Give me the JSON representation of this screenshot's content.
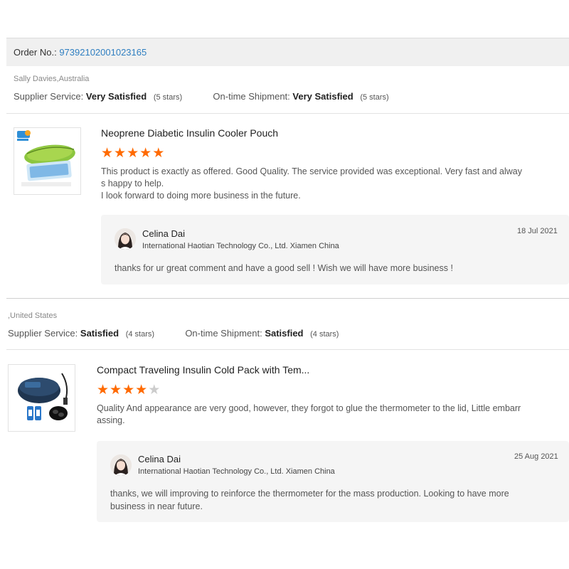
{
  "order": {
    "label": "Order No.:",
    "number": "97392102001023165"
  },
  "reviews": [
    {
      "reviewer": "Sally Davies,Australia",
      "supplier_service_label": "Supplier Service:",
      "supplier_service_value": "Very Satisfied",
      "supplier_service_stars": "(5 stars)",
      "shipment_label": "On-time Shipment:",
      "shipment_value": "Very Satisfied",
      "shipment_stars": "(5 stars)",
      "product_title": "Neoprene Diabetic Insulin Cooler Pouch",
      "rating": 5,
      "rating_max": 5,
      "text_line1": "This product is exactly as offered. Good Quality. The service provided was exceptional. Very fast and alway",
      "text_line2": "s happy to help.",
      "text_line3": "I look forward to doing more business in the future.",
      "reply": {
        "name": "Celina Dai",
        "company": "International Haotian Technology Co., Ltd. Xiamen China",
        "date": "18 Jul 2021",
        "text_line1": "thanks for ur great comment and have a good sell ! Wish we will have more business !",
        "text_line2": ""
      }
    },
    {
      "reviewer": ",United States",
      "supplier_service_label": "Supplier Service:",
      "supplier_service_value": "Satisfied",
      "supplier_service_stars": "(4 stars)",
      "shipment_label": "On-time Shipment:",
      "shipment_value": "Satisfied",
      "shipment_stars": "(4 stars)",
      "product_title": "Compact Traveling Insulin Cold Pack with Tem...",
      "rating": 4,
      "rating_max": 5,
      "text_line1": "Quality And appearance are very good, however, they forgot to glue the thermometer to the lid, Little embarr",
      "text_line2": "assing.",
      "text_line3": "",
      "reply": {
        "name": "Celina Dai",
        "company": "International Haotian Technology Co., Ltd. Xiamen China",
        "date": "25 Aug 2021",
        "text_line1": "thanks, we will improving to reinforce the thermometer for the mass production. Looking to have more",
        "text_line2": "business in near future."
      }
    }
  ],
  "colors": {
    "star_on": "#ff6a00",
    "star_off": "#cccccc",
    "link": "#2f7fc1"
  }
}
